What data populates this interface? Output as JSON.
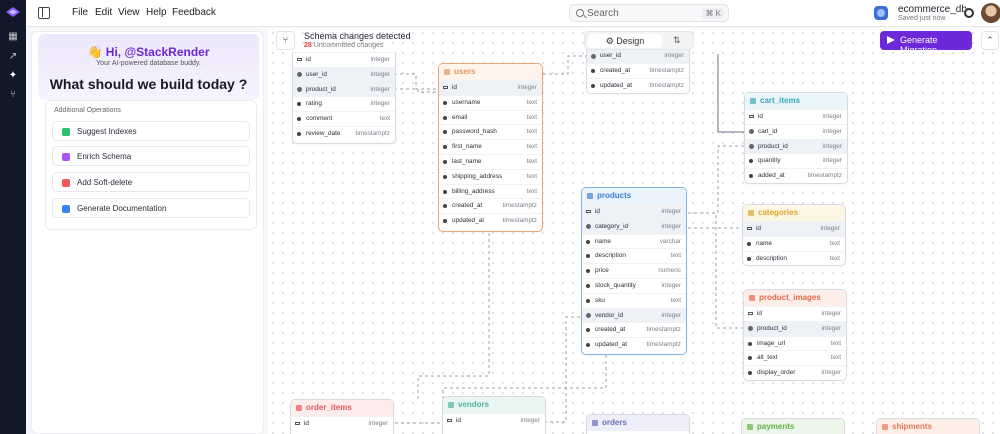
{
  "app": {
    "menu": [
      "File",
      "Edit",
      "View",
      "Help",
      "Feedback"
    ],
    "search_placeholder": "Search",
    "search_shortcut": "⌘ K",
    "db_name": "ecommerce_db",
    "db_status": "Saved just now"
  },
  "assistant": {
    "greeting": "Hi, @StackRender",
    "wave": "👋",
    "subtitle": "Your AI-powered database buddy.",
    "question": "What should we build today ?",
    "ops_title": "Additional Operations",
    "ops": [
      {
        "label": "Suggest Indexes",
        "color": "#2fbf71"
      },
      {
        "label": "Enrich Schema",
        "color": "#a855f7"
      },
      {
        "label": "Add Soft-delete",
        "color": "#ef5a5a"
      },
      {
        "label": "Generate Documentation",
        "color": "#3b82f6"
      }
    ]
  },
  "toolbar": {
    "changes_title": "Schema changes detected",
    "changes_count": "28",
    "changes_suffix": "Uncommitted changes",
    "mode_label": "Design",
    "sort_icon": "⇅",
    "migrate_label": "Generate Migration",
    "collapse_icon": "⌃"
  },
  "tables": {
    "reviews_partial": {
      "title": "",
      "color": "#d8dbe1",
      "rows": [
        {
          "name": "id",
          "type": "integer",
          "kind": "key"
        },
        {
          "name": "user_id",
          "type": "integer",
          "kind": "fk"
        },
        {
          "name": "product_id",
          "type": "integer",
          "kind": "fk"
        },
        {
          "name": "rating",
          "type": "integer",
          "kind": "col"
        },
        {
          "name": "comment",
          "type": "text",
          "kind": "col"
        },
        {
          "name": "review_date",
          "type": "timestamptz",
          "kind": "col"
        }
      ]
    },
    "users": {
      "title": "users",
      "color": "#e8925a",
      "rows": [
        {
          "name": "id",
          "type": "integer",
          "kind": "key"
        },
        {
          "name": "username",
          "type": "text",
          "kind": "col"
        },
        {
          "name": "email",
          "type": "text",
          "kind": "col"
        },
        {
          "name": "password_hash",
          "type": "text",
          "kind": "col"
        },
        {
          "name": "first_name",
          "type": "text",
          "kind": "col"
        },
        {
          "name": "last_name",
          "type": "text",
          "kind": "col"
        },
        {
          "name": "shipping_address",
          "type": "text",
          "kind": "col"
        },
        {
          "name": "billing_address",
          "type": "text",
          "kind": "col"
        },
        {
          "name": "created_at",
          "type": "timestamptz",
          "kind": "col"
        },
        {
          "name": "updated_at",
          "type": "timestamptz",
          "kind": "col"
        }
      ]
    },
    "carts_partial": {
      "title": "",
      "color": "#d8dbe1",
      "rows": [
        {
          "name": "user_id",
          "type": "integer",
          "kind": "fk"
        },
        {
          "name": "created_at",
          "type": "timestamptz",
          "kind": "col"
        },
        {
          "name": "updated_at",
          "type": "timestamptz",
          "kind": "col"
        }
      ]
    },
    "cart_items": {
      "title": "cart_items",
      "color": "#3aa6b9",
      "rows": [
        {
          "name": "id",
          "type": "integer",
          "kind": "key"
        },
        {
          "name": "cart_id",
          "type": "integer",
          "kind": "fk"
        },
        {
          "name": "product_id",
          "type": "integer",
          "kind": "fk"
        },
        {
          "name": "quantity",
          "type": "integer",
          "kind": "col"
        },
        {
          "name": "added_at",
          "type": "timestamptz",
          "kind": "col"
        }
      ]
    },
    "products": {
      "title": "products",
      "color": "#3b82d6",
      "rows": [
        {
          "name": "id",
          "type": "integer",
          "kind": "key"
        },
        {
          "name": "category_id",
          "type": "integer",
          "kind": "fk"
        },
        {
          "name": "name",
          "type": "varchar",
          "kind": "col"
        },
        {
          "name": "description",
          "type": "text",
          "kind": "col"
        },
        {
          "name": "price",
          "type": "numeric",
          "kind": "col"
        },
        {
          "name": "stock_quantity",
          "type": "integer",
          "kind": "col"
        },
        {
          "name": "sku",
          "type": "text",
          "kind": "col"
        },
        {
          "name": "vendor_id",
          "type": "integer",
          "kind": "fk"
        },
        {
          "name": "created_at",
          "type": "timestamptz",
          "kind": "col"
        },
        {
          "name": "updated_at",
          "type": "timestamptz",
          "kind": "col"
        }
      ]
    },
    "categories": {
      "title": "categories",
      "color": "#e0a52c",
      "rows": [
        {
          "name": "id",
          "type": "integer",
          "kind": "key"
        },
        {
          "name": "name",
          "type": "text",
          "kind": "col"
        },
        {
          "name": "description",
          "type": "text",
          "kind": "col"
        }
      ]
    },
    "product_images": {
      "title": "product_images",
      "color": "#e06a4a",
      "rows": [
        {
          "name": "id",
          "type": "integer",
          "kind": "key"
        },
        {
          "name": "product_id",
          "type": "integer",
          "kind": "fk"
        },
        {
          "name": "image_url",
          "type": "text",
          "kind": "col"
        },
        {
          "name": "alt_text",
          "type": "text",
          "kind": "col"
        },
        {
          "name": "display_order",
          "type": "integer",
          "kind": "col"
        }
      ]
    },
    "order_items": {
      "title": "order_items",
      "color": "#e0585c",
      "rows": [
        {
          "name": "id",
          "type": "integer",
          "kind": "key"
        }
      ]
    },
    "vendors": {
      "title": "vendors",
      "color": "#4fb3a0",
      "rows": [
        {
          "name": "id",
          "type": "integer",
          "kind": "key"
        }
      ]
    },
    "orders": {
      "title": "orders",
      "color": "#6b6fb8",
      "rows": []
    },
    "payments": {
      "title": "payments",
      "color": "#5fb24a",
      "rows": []
    },
    "shipments": {
      "title": "shipments",
      "color": "#e07a5a",
      "rows": []
    }
  }
}
